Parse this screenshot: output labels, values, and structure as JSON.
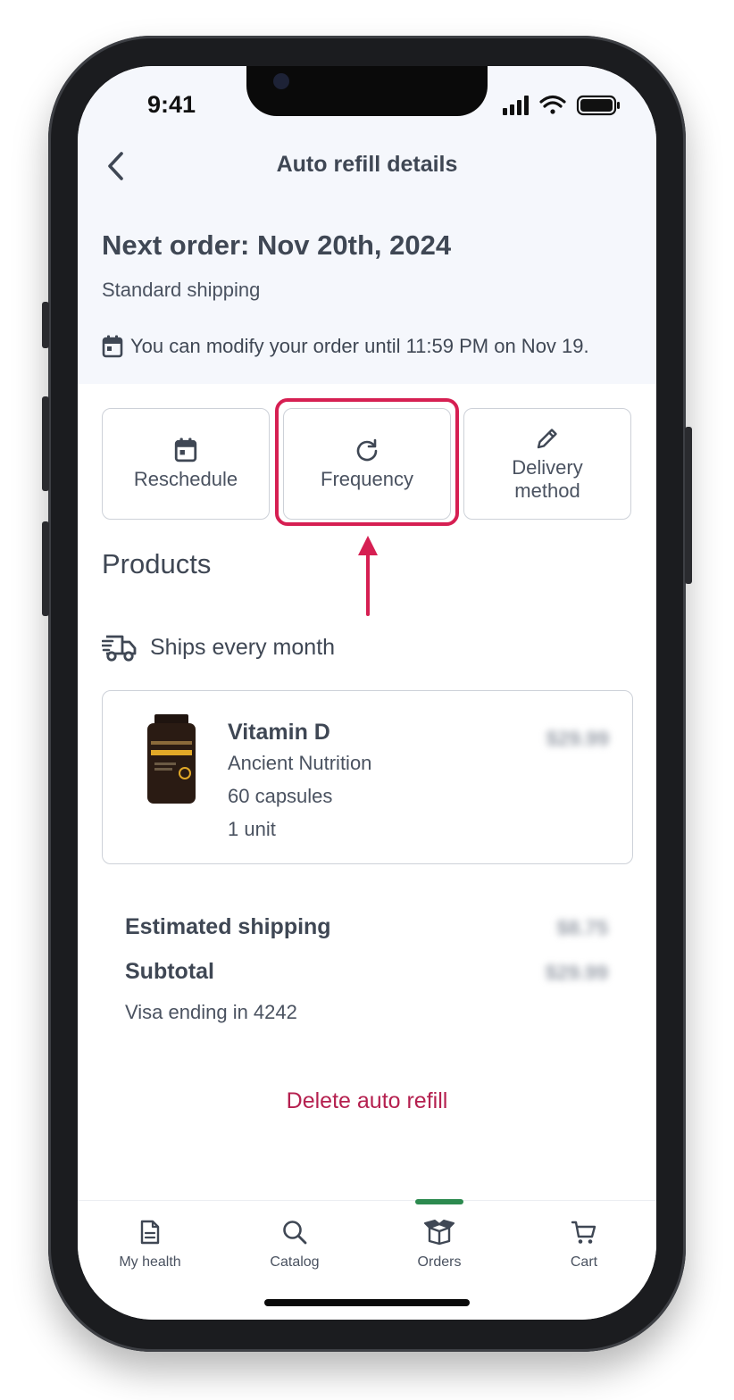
{
  "status_bar": {
    "time": "9:41"
  },
  "nav": {
    "title": "Auto refill details"
  },
  "order": {
    "next_order": "Next order: Nov 20th, 2024",
    "shipping_method": "Standard shipping",
    "modify_notice": "You can modify your order until 11:59 PM on Nov 19."
  },
  "actions": [
    {
      "label": "Reschedule",
      "icon": "calendar-icon"
    },
    {
      "label": "Frequency",
      "icon": "refresh-icon"
    },
    {
      "label_line1": "Delivery",
      "label_line2": "method",
      "icon": "pencil-icon"
    }
  ],
  "products": {
    "title": "Products",
    "ships_frequency": "Ships every month",
    "items": [
      {
        "name": "Vitamin D",
        "brand": "Ancient Nutrition",
        "size": "60 capsules",
        "quantity": "1 unit",
        "price": "$29.99"
      }
    ]
  },
  "summary": {
    "estimated_shipping_label": "Estimated shipping",
    "estimated_shipping_value": "$8.75",
    "subtotal_label": "Subtotal",
    "subtotal_value": "$29.99",
    "payment": "Visa ending in 4242"
  },
  "delete_label": "Delete auto refill",
  "tabs": [
    {
      "label": "My health",
      "icon": "document-icon"
    },
    {
      "label": "Catalog",
      "icon": "search-icon"
    },
    {
      "label": "Orders",
      "icon": "box-icon",
      "active": true
    },
    {
      "label": "Cart",
      "icon": "cart-icon"
    }
  ],
  "colors": {
    "accent_highlight": "#d61f52",
    "delete_text": "#b5204f",
    "active_tab": "#2c8a4f",
    "text_primary": "#3f4754",
    "header_bg": "#f5f7fc"
  }
}
